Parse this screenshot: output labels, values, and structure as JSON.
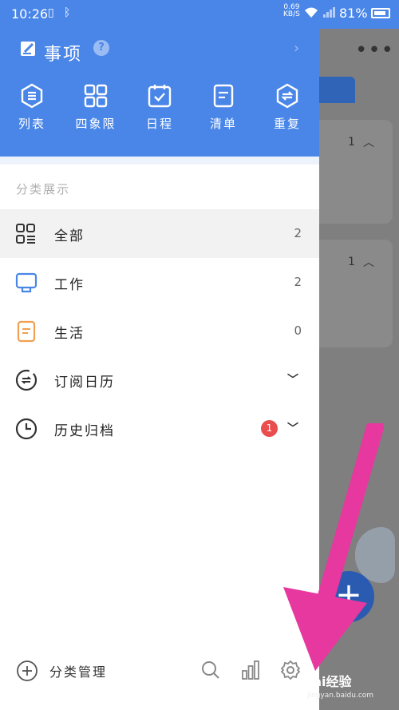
{
  "status_bar": {
    "time": "10:26",
    "net_speed": "0.69",
    "net_unit": "KB/S",
    "battery": "81%"
  },
  "drawer": {
    "title": "事项",
    "help": "?",
    "quick_actions": [
      {
        "label": "列表",
        "icon": "list-icon"
      },
      {
        "label": "四象限",
        "icon": "quadrant-grid-icon"
      },
      {
        "label": "日程",
        "icon": "calendar-check-icon"
      },
      {
        "label": "清单",
        "icon": "checklist-doc-icon"
      },
      {
        "label": "重复",
        "icon": "repeat-icon"
      }
    ],
    "section_title": "分类展示",
    "categories": [
      {
        "label": "全部",
        "count": "2",
        "icon": "all-grid-icon"
      },
      {
        "label": "工作",
        "count": "2",
        "icon": "monitor-icon"
      },
      {
        "label": "生活",
        "count": "0",
        "icon": "note-icon"
      },
      {
        "label": "订阅日历",
        "icon": "subscribe-icon"
      },
      {
        "label": "历史归档",
        "badge": "1",
        "icon": "clock-icon"
      }
    ],
    "bottom": {
      "manage_label": "分类管理"
    }
  },
  "background": {
    "card1_count": "1",
    "card2_count": "1",
    "fab": "+"
  },
  "watermark": {
    "brand": "Bai经验",
    "url": "jingyan.baidu.com"
  },
  "colors": {
    "header": "#4a86e8",
    "accent_orange": "#f0a050",
    "badge": "#ea4d4d",
    "arrow": "#e6389e"
  }
}
